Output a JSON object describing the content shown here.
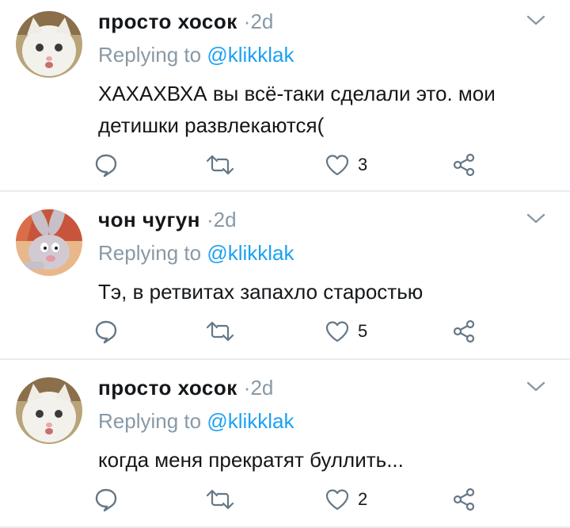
{
  "colors": {
    "name": "#14171a",
    "muted": "#8899a6",
    "link": "#1da1f2",
    "divider": "#e6ecf0"
  },
  "icons": {
    "reply": "speech-bubble-icon",
    "retweet": "retweet-arrows-icon",
    "like": "heart-icon",
    "share": "share-nodes-icon",
    "more": "chevron-down-icon"
  },
  "tweets": [
    {
      "name": "просто хосок",
      "separator": "·",
      "time": "2d",
      "replying_label": "Replying to",
      "replying_handle": "@klikklak",
      "text": "ХАХАХВХА вы всё-таки сделали это. мои детишки развлекаются(",
      "likes": "3"
    },
    {
      "name": "чон чугун",
      "separator": "·",
      "time": "2d",
      "replying_label": "Replying to",
      "replying_handle": "@klikklak",
      "text": "Тэ, в ретвитах запахло старостью",
      "likes": "5"
    },
    {
      "name": "просто хосок",
      "separator": "·",
      "time": "2d",
      "replying_label": "Replying to",
      "replying_handle": "@klikklak",
      "text": "когда меня прекратят буллить...",
      "likes": "2"
    }
  ]
}
